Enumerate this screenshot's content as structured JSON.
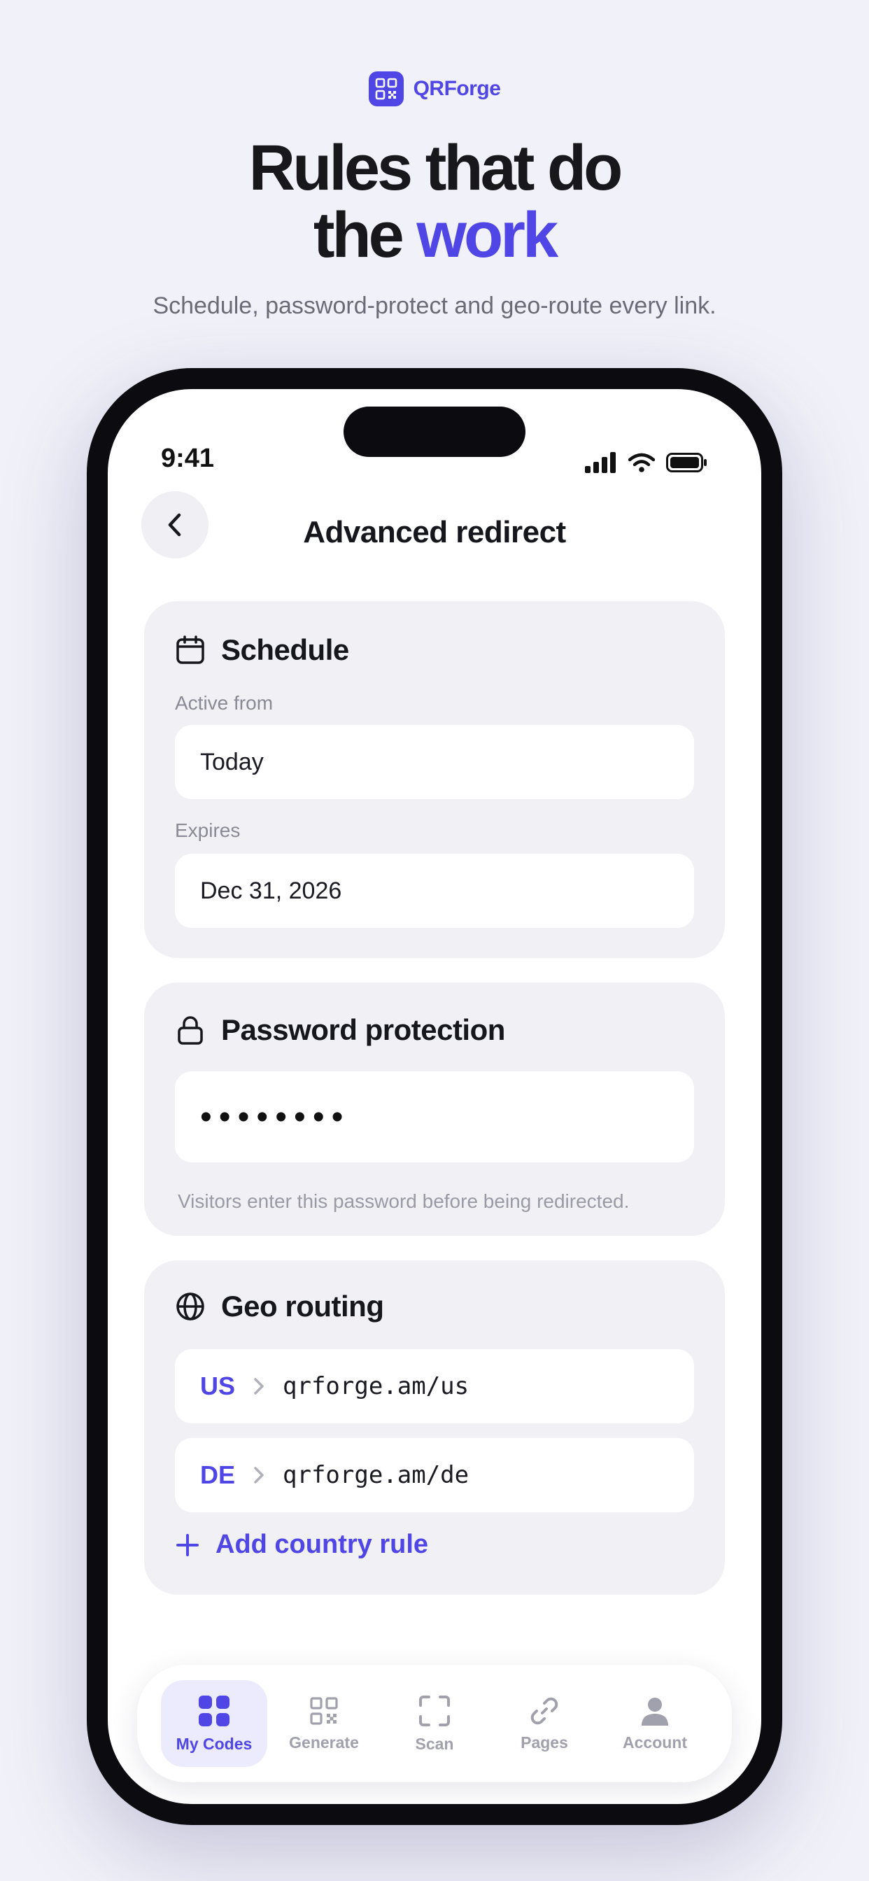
{
  "brand": {
    "name": "QRForge"
  },
  "headline": {
    "line1": "Rules that do",
    "line2_plain": "the ",
    "line2_accent": "work"
  },
  "subline": "Schedule, password-protect and geo-route every link.",
  "status_bar": {
    "time": "9:41"
  },
  "screen": {
    "title": "Advanced redirect"
  },
  "schedule": {
    "title": "Schedule",
    "active_from_label": "Active from",
    "active_from_value": "Today",
    "expires_label": "Expires",
    "expires_value": "Dec 31, 2026"
  },
  "password": {
    "title": "Password protection",
    "value_masked": "••••••••",
    "helper": "Visitors enter this password before being redirected."
  },
  "geo": {
    "title": "Geo routing",
    "rules": [
      {
        "country": "US",
        "url": "qrforge.am/us"
      },
      {
        "country": "DE",
        "url": "qrforge.am/de"
      }
    ],
    "add_label": "Add country rule"
  },
  "tabbar": {
    "tabs": [
      {
        "label": "My Codes",
        "icon": "grid-icon",
        "active": true
      },
      {
        "label": "Generate",
        "icon": "qr-icon",
        "active": false
      },
      {
        "label": "Scan",
        "icon": "scan-frame-icon",
        "active": false
      },
      {
        "label": "Pages",
        "icon": "link-icon",
        "active": false
      },
      {
        "label": "Account",
        "icon": "person-icon",
        "active": false
      }
    ]
  },
  "colors": {
    "accent": "#4f46e5",
    "background": "#f1f1f9",
    "card": "#f0f0f5"
  }
}
